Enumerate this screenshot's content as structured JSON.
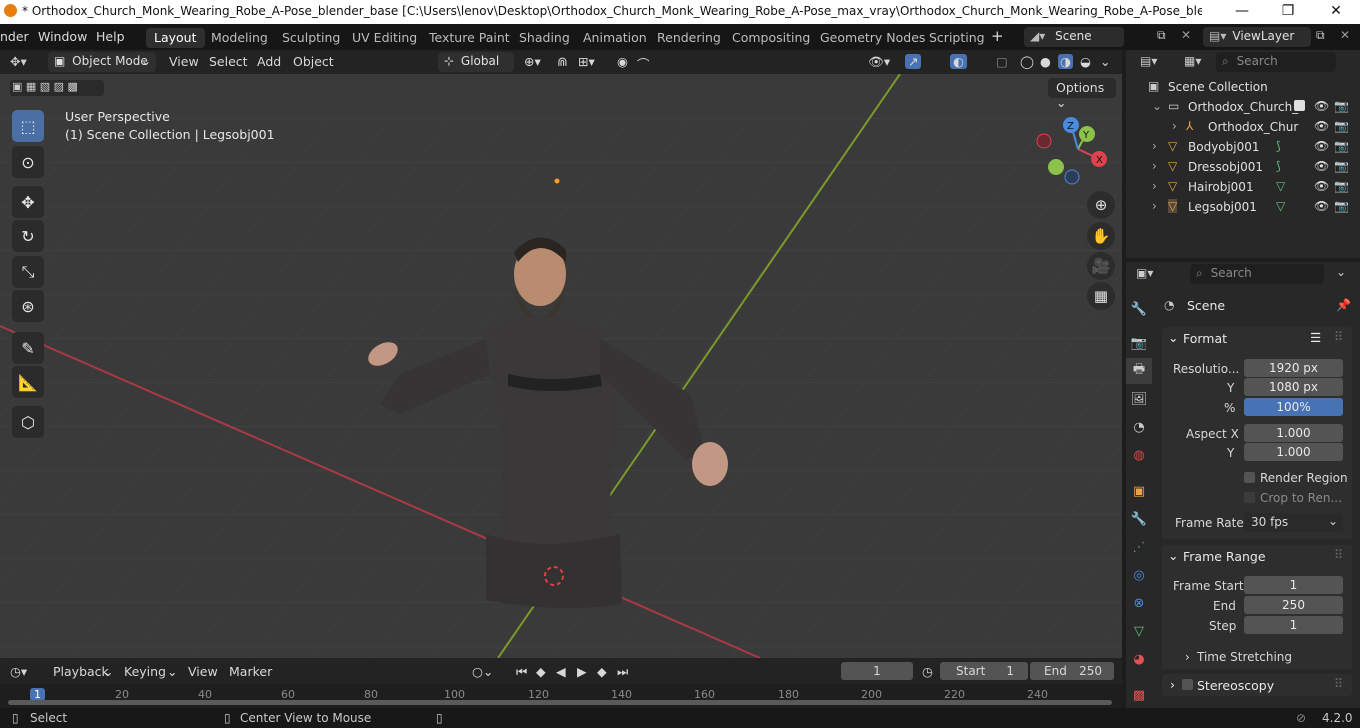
{
  "window": {
    "title": "* Orthodox_Church_Monk_Wearing_Robe_A-Pose_blender_base [C:\\Users\\lenov\\Desktop\\Orthodox_Church_Monk_Wearing_Robe_A-Pose_max_vray\\Orthodox_Church_Monk_Wearing_Robe_A-Pose_blender_base.blend] - Ble...",
    "controls": [
      "—",
      "❐",
      "✕"
    ]
  },
  "menubar": {
    "items": [
      "nder",
      "Window",
      "Help"
    ]
  },
  "workspaces": {
    "tabs": [
      "Layout",
      "Modeling",
      "Sculpting",
      "UV Editing",
      "Texture Paint",
      "Shading",
      "Animation",
      "Rendering",
      "Compositing",
      "Geometry Nodes",
      "Scripting"
    ],
    "active": "Layout",
    "add_label": "+"
  },
  "scene_selector": {
    "value": "Scene"
  },
  "viewlayer_selector": {
    "value": "ViewLayer"
  },
  "viewport_header": {
    "mode": "Object Mode",
    "menus": [
      "View",
      "Select",
      "Add",
      "Object"
    ],
    "transform_orientation": "Global",
    "options_label": "Options"
  },
  "viewport": {
    "perspective_label": "User Perspective",
    "collection_label": "(1) Scene Collection | Legsobj001",
    "gizmo_axes": {
      "x": "X",
      "y": "Y",
      "z": "Z"
    },
    "colors": {
      "x": "#e0414f",
      "y": "#8bc34a",
      "z": "#4a8bdf",
      "bg": "#3a3a3a",
      "grid": "#454545"
    }
  },
  "outliner": {
    "search_placeholder": "Search",
    "root": "Scene Collection",
    "items": [
      {
        "label": "Orthodox_Church_",
        "level": 1
      },
      {
        "label": "Orthodox_Chur",
        "level": 2
      },
      {
        "label": "Bodyobj001",
        "level": 1
      },
      {
        "label": "Dressobj001",
        "level": 1
      },
      {
        "label": "Hairobj001",
        "level": 1
      },
      {
        "label": "Legsobj001",
        "level": 1
      }
    ]
  },
  "properties": {
    "search_placeholder": "Search",
    "context": "Scene",
    "format_panel": {
      "title": "Format",
      "resolution_x_label": "Resolutio...",
      "resolution_x": "1920 px",
      "resolution_y_label": "Y",
      "resolution_y": "1080 px",
      "percent_label": "%",
      "percent": "100%",
      "aspect_x_label": "Aspect X",
      "aspect_x": "1.000",
      "aspect_y_label": "Y",
      "aspect_y": "1.000",
      "render_region": "Render Region",
      "crop_to_render": "Crop to Ren...",
      "frame_rate_label": "Frame Rate",
      "frame_rate": "30 fps"
    },
    "frame_range_panel": {
      "title": "Frame Range",
      "start_label": "Frame Start",
      "start": "1",
      "end_label": "End",
      "end": "250",
      "step_label": "Step",
      "step": "1"
    },
    "time_stretching": "Time Stretching",
    "stereoscopy": "Stereoscopy"
  },
  "timeline": {
    "menus": [
      "Playback",
      "Keying",
      "View",
      "Marker"
    ],
    "current_frame": "1",
    "start_label": "Start",
    "start": "1",
    "end_label": "End",
    "end": "250",
    "ticks": [
      "1",
      "20",
      "40",
      "60",
      "80",
      "100",
      "120",
      "140",
      "160",
      "180",
      "200",
      "220",
      "240"
    ]
  },
  "statusbar": {
    "select": "Select",
    "center_view": "Center View to Mouse",
    "version": "4.2.0"
  }
}
